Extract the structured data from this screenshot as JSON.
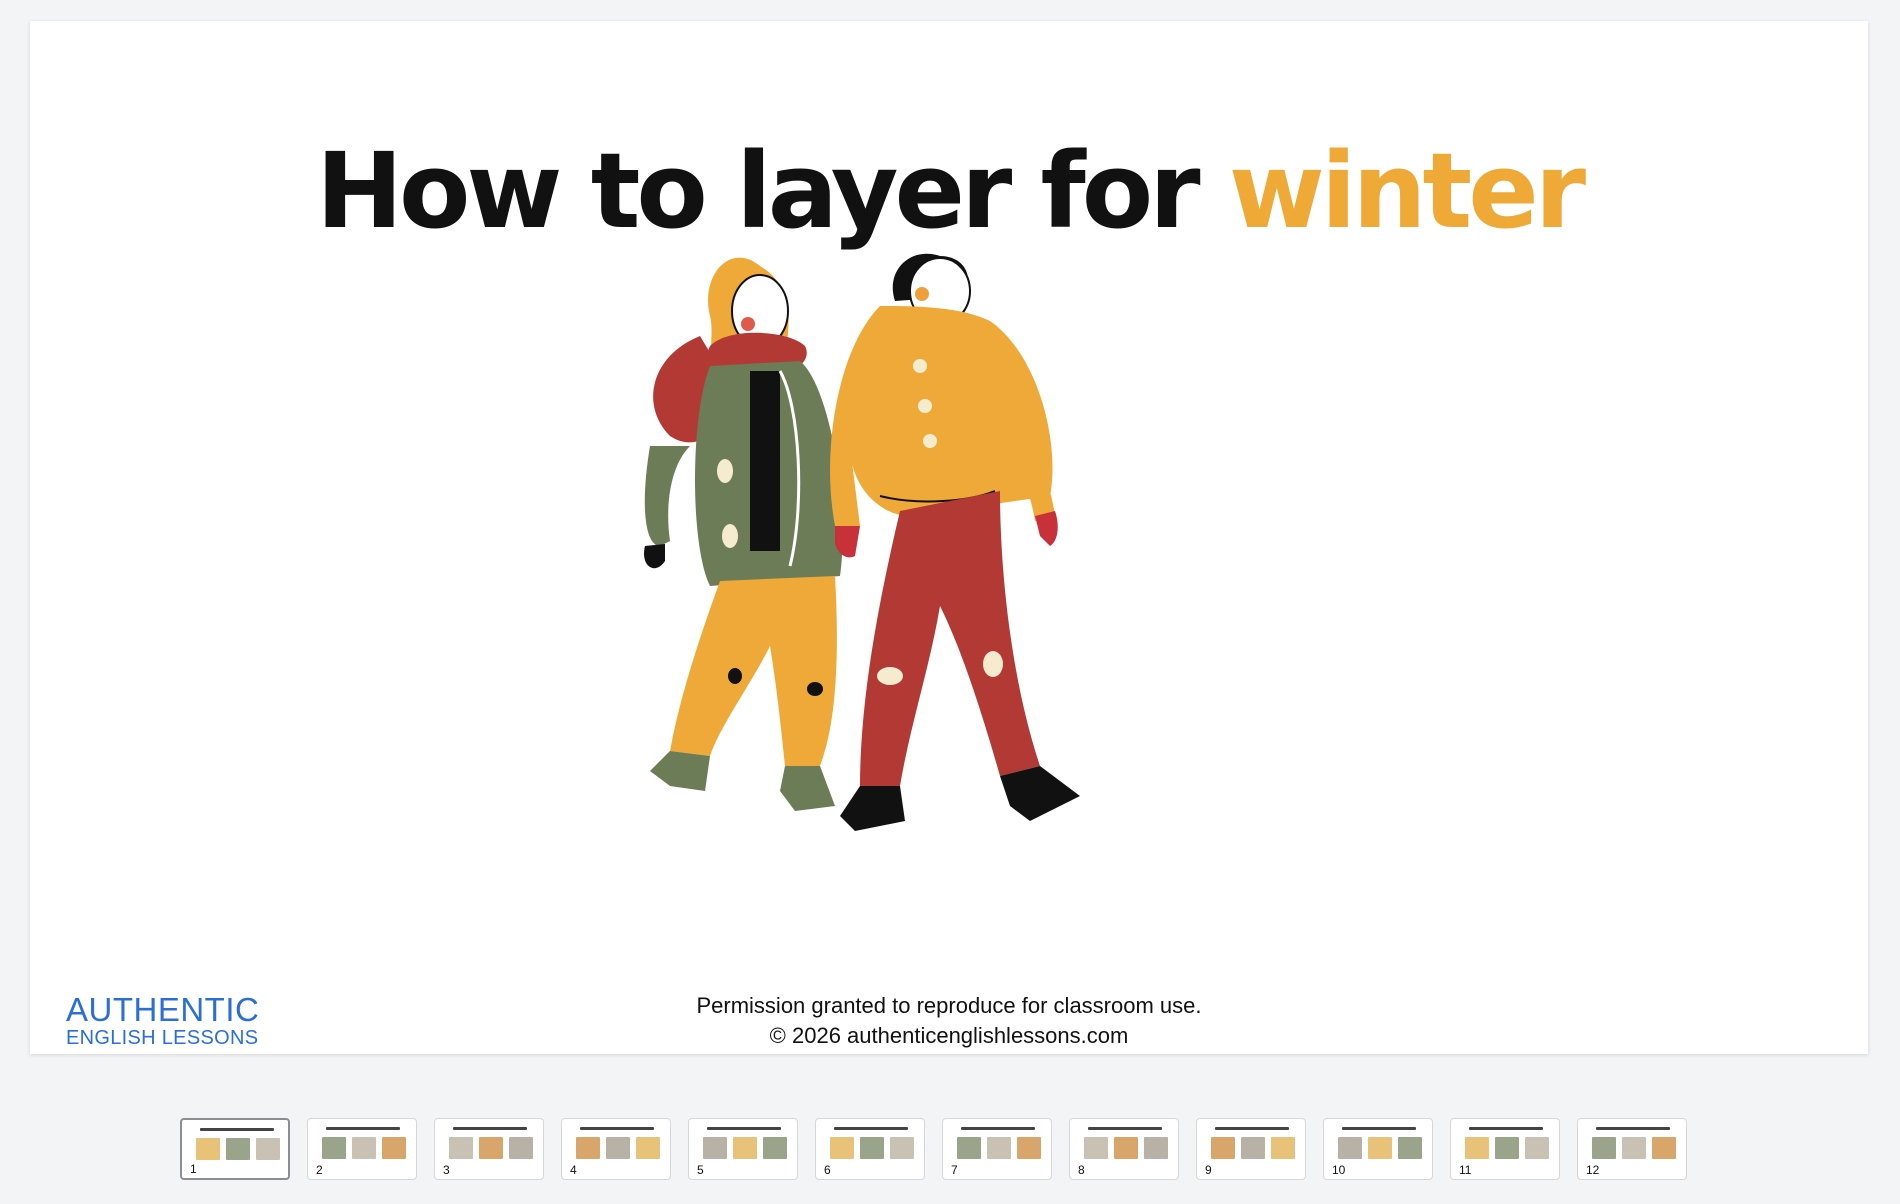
{
  "slide": {
    "title_main": "How to layer for ",
    "title_accent": "winter",
    "logo_line1": "AUTHENTIC",
    "logo_line2": "ENGLISH LESSONS",
    "permission_line1": "Permission granted to reproduce for classroom use.",
    "permission_line2": "© 2026 authenticenglishlessons.com"
  },
  "colors": {
    "accent": "#eea936",
    "coat_green": "#6b7c56",
    "scarf_red": "#b33a34",
    "sweater_yellow": "#efa938",
    "logo_blue": "#2b6fd6"
  },
  "thumbnails": [
    {
      "number": "1",
      "active": true
    },
    {
      "number": "2",
      "active": false
    },
    {
      "number": "3",
      "active": false
    },
    {
      "number": "4",
      "active": false
    },
    {
      "number": "5",
      "active": false
    },
    {
      "number": "6",
      "active": false
    },
    {
      "number": "7",
      "active": false
    },
    {
      "number": "8",
      "active": false
    },
    {
      "number": "9",
      "active": false
    },
    {
      "number": "10",
      "active": false
    },
    {
      "number": "11",
      "active": false
    },
    {
      "number": "12",
      "active": false
    }
  ]
}
